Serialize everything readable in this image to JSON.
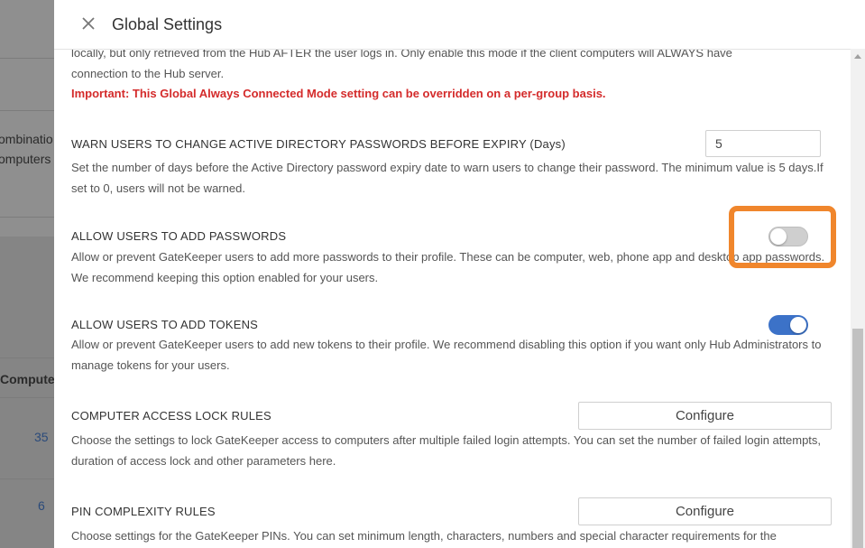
{
  "background": {
    "lines": [
      "ombinatio",
      "omputers"
    ],
    "column_header": "Compute",
    "values": [
      "35",
      "6"
    ]
  },
  "modal": {
    "title": "Global Settings",
    "close_icon": "close-icon"
  },
  "intro": {
    "line1": "locally, but only retrieved from the Hub AFTER the user logs in. Only enable this mode if the client computers will ALWAYS have",
    "line2": "connection to the Hub server.",
    "important": "Important: This Global Always Connected Mode setting can be overridden on a per-group basis."
  },
  "settings": {
    "warn_expiry": {
      "title": "WARN USERS TO CHANGE ACTIVE DIRECTORY PASSWORDS BEFORE EXPIRY (Days)",
      "value": "5",
      "description": "Set the number of days before the Active Directory password expiry date to warn users to change their password. The minimum value is 5 days.If set to 0, users will not be warned."
    },
    "add_passwords": {
      "title": "ALLOW USERS TO ADD PASSWORDS",
      "enabled": false,
      "description": "Allow or prevent GateKeeper users to add more passwords to their profile. These can be computer, web, phone app and desktop app passwords. We recommend keeping this option enabled for your users."
    },
    "add_tokens": {
      "title": "ALLOW USERS TO ADD TOKENS",
      "enabled": true,
      "description": "Allow or prevent GateKeeper users to add new tokens to their profile. We recommend disabling this option if you want only Hub Administrators to manage tokens for your users."
    },
    "lock_rules": {
      "title": "COMPUTER ACCESS LOCK RULES",
      "button": "Configure",
      "description": "Choose the settings to lock GateKeeper access to computers after multiple failed login attempts. You can set the number of failed login attempts, duration of access lock and other parameters here."
    },
    "pin_rules": {
      "title": "PIN COMPLEXITY RULES",
      "button": "Configure",
      "description": "Choose settings for the GateKeeper PINs. You can set minimum length, characters, numbers and special character requirements for the"
    }
  },
  "colors": {
    "important": "#d42b2b",
    "toggle_on": "#3c72c8",
    "highlight": "#f0862c"
  }
}
